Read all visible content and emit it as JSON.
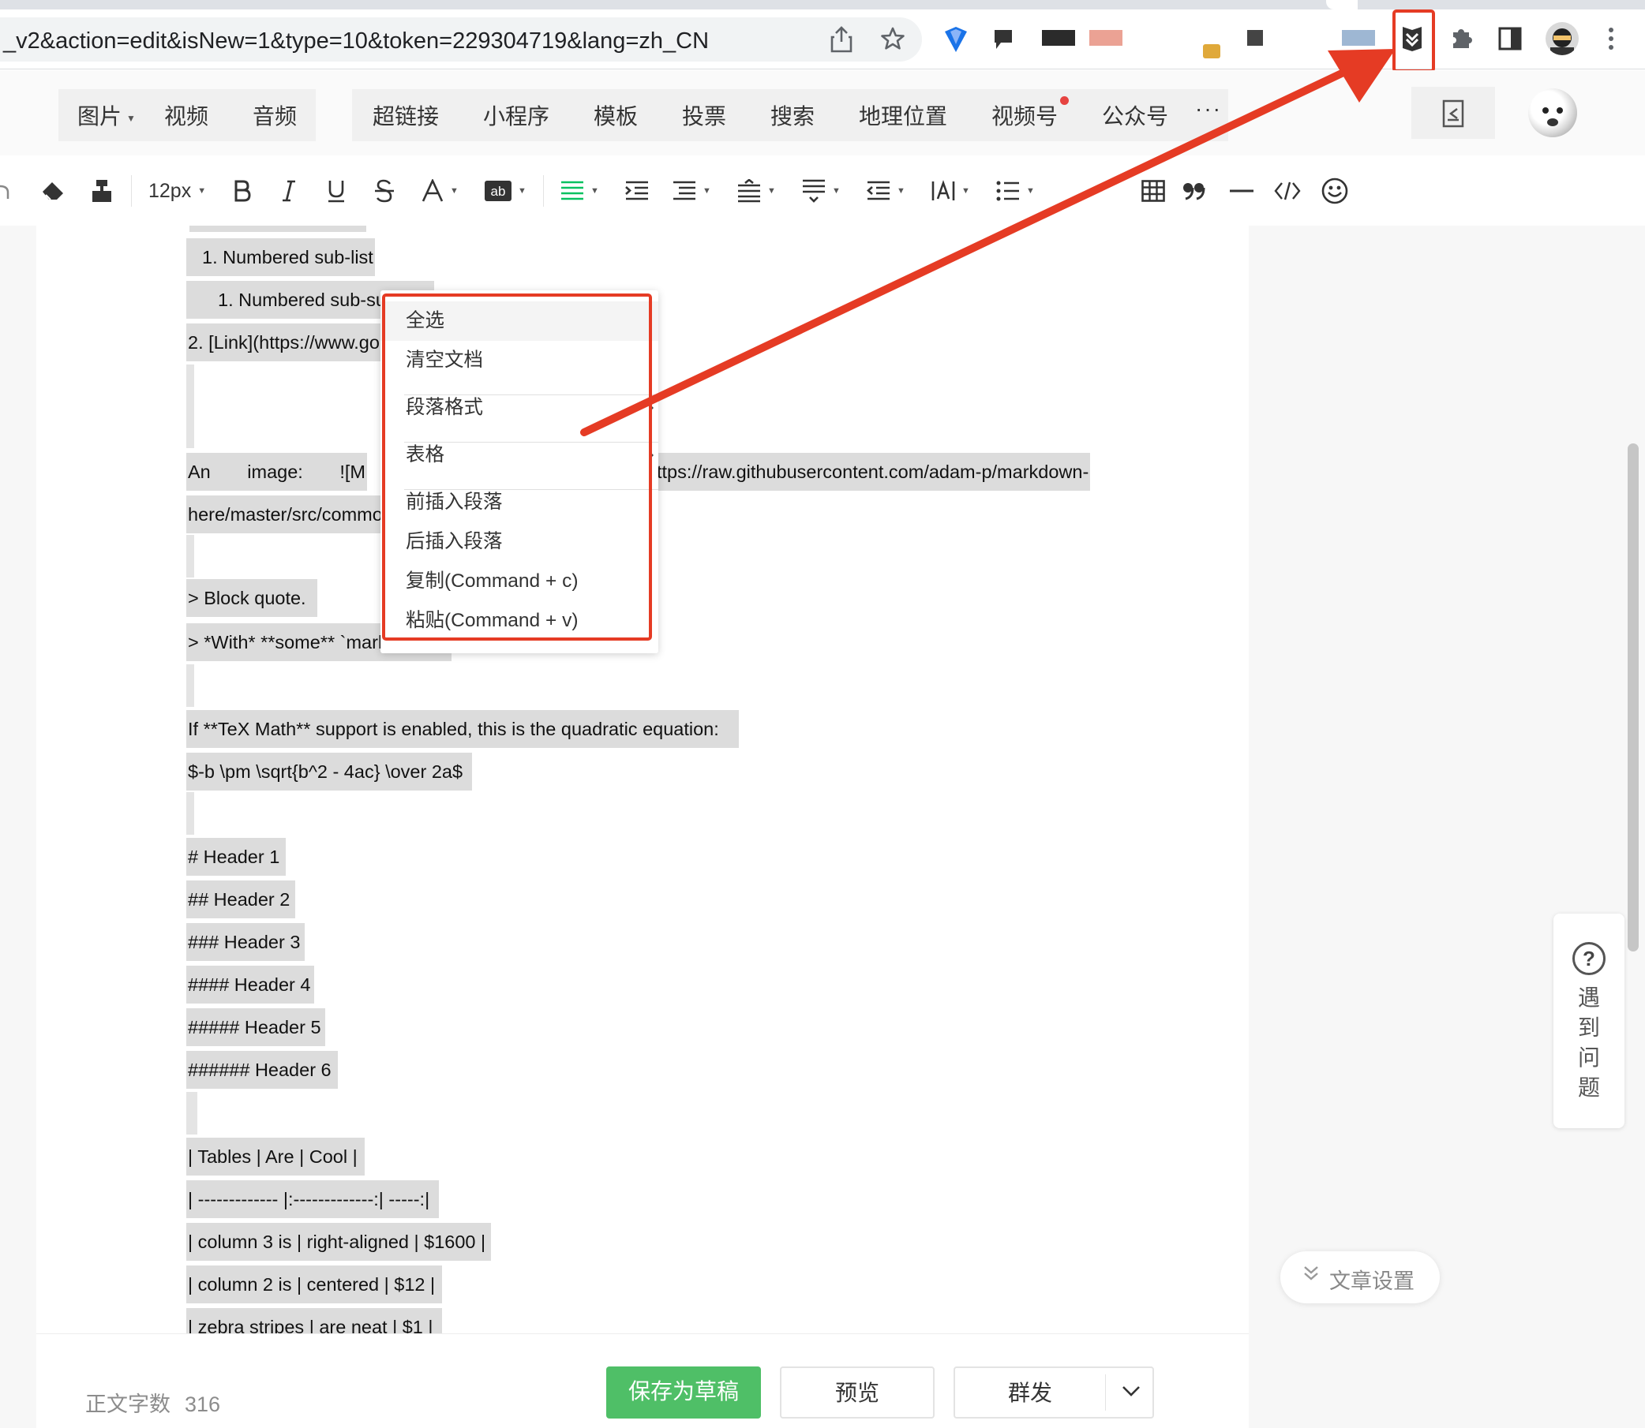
{
  "browser": {
    "url": "_v2&action=edit&isNew=1&type=10&token=229304719&lang=zh_CN"
  },
  "insert_bar": {
    "items": [
      {
        "label": "图片",
        "has_caret": true
      },
      {
        "label": "视频"
      },
      {
        "label": "音频"
      },
      {
        "label": "超链接"
      },
      {
        "label": "小程序"
      },
      {
        "label": "模板"
      },
      {
        "label": "投票"
      },
      {
        "label": "搜索"
      },
      {
        "label": "地理位置"
      },
      {
        "label": "视频号",
        "badge": true
      },
      {
        "label": "公众号"
      },
      {
        "label": "···"
      }
    ]
  },
  "format_toolbar": {
    "font_size": "12px"
  },
  "editor": {
    "lines": [
      "1. Numbered sub-list",
      "1. Numbered sub-sub-list",
      "2. [Link](https://www.goo",
      "An        image:        ![M",
      "ttps://raw.githubusercontent.com/adam-p/markdown-",
      "here/master/src/commo",
      "> Block quote.",
      "> *With* **some** `mark",
      "If **TeX Math** support is enabled, this is the quadratic equation:",
      "$-b \\pm \\sqrt{b^2 - 4ac} \\over 2a$",
      "# Header 1",
      "## Header 2",
      "### Header 3",
      "#### Header 4",
      "##### Header 5",
      "###### Header 6",
      "| Tables | Are | Cool |",
      "| ------------- |:-------------:| -----:|",
      "| column 3 is | right-aligned | $1600 |",
      "| column 2 is | centered | $12 |",
      "| zebra stripes | are neat | $1 |"
    ]
  },
  "context_menu": {
    "items": [
      {
        "label": "全选"
      },
      {
        "label": "清空文档"
      },
      {
        "label": "段落格式",
        "submenu": true
      },
      {
        "label": "表格",
        "submenu": true
      },
      {
        "label": "前插入段落"
      },
      {
        "label": "后插入段落"
      },
      {
        "label": "复制(Command + c)"
      },
      {
        "label": "粘贴(Command + v)"
      }
    ]
  },
  "help": {
    "icon_text": "?",
    "label": "遇到问题"
  },
  "article_settings": {
    "label": "文章设置"
  },
  "bottom": {
    "word_count_label": "正文字数",
    "word_count": "316",
    "save_draft": "保存为草稿",
    "preview": "预览",
    "mass_send": "群发"
  },
  "colors": {
    "annotation_red": "#e53b24",
    "primary_green": "#4fbf67",
    "selection_gray": "#dcdcdc"
  }
}
